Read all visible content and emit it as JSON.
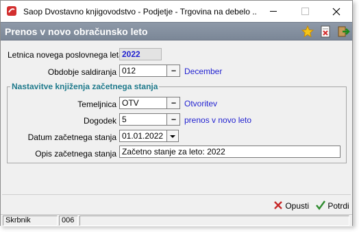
{
  "window": {
    "title": "Saop Dvostavno knjigovodstvo - Podjetje - Trgovina na debelo ..."
  },
  "header": {
    "title": "Prenos v novo obračunsko leto",
    "icons": [
      "favorite-star-icon",
      "delete-document-icon",
      "exit-icon"
    ]
  },
  "form": {
    "year_label": "Letnica novega poslovnega leta",
    "year_value": "2022",
    "period_label": "Obdobje saldiranja",
    "period_value": "012",
    "period_desc": "December",
    "group_title": "Nastavitve knjiženja začetnega stanja",
    "ledger_label": "Temeljnica",
    "ledger_value": "OTV",
    "ledger_desc": "Otvoritev",
    "event_label": "Dogodek",
    "event_value": "5",
    "event_desc": "prenos v novo leto",
    "date_label": "Datum začetnega stanja",
    "date_value": "01.01.2022",
    "desc_label": "Opis začetnega stanja",
    "desc_value": "Začetno stanje za leto: 2022",
    "dots": "..."
  },
  "actions": {
    "cancel_label": "Opusti",
    "confirm_label": "Potrdi",
    "cancel_color": "#c62828",
    "confirm_color": "#2e8b2e"
  },
  "status": {
    "user": "Skrbnik",
    "code": "006"
  },
  "colors": {
    "header_bg": "#8590a0",
    "link_blue": "#1f1fd0",
    "group_title": "#1f7a8c"
  }
}
